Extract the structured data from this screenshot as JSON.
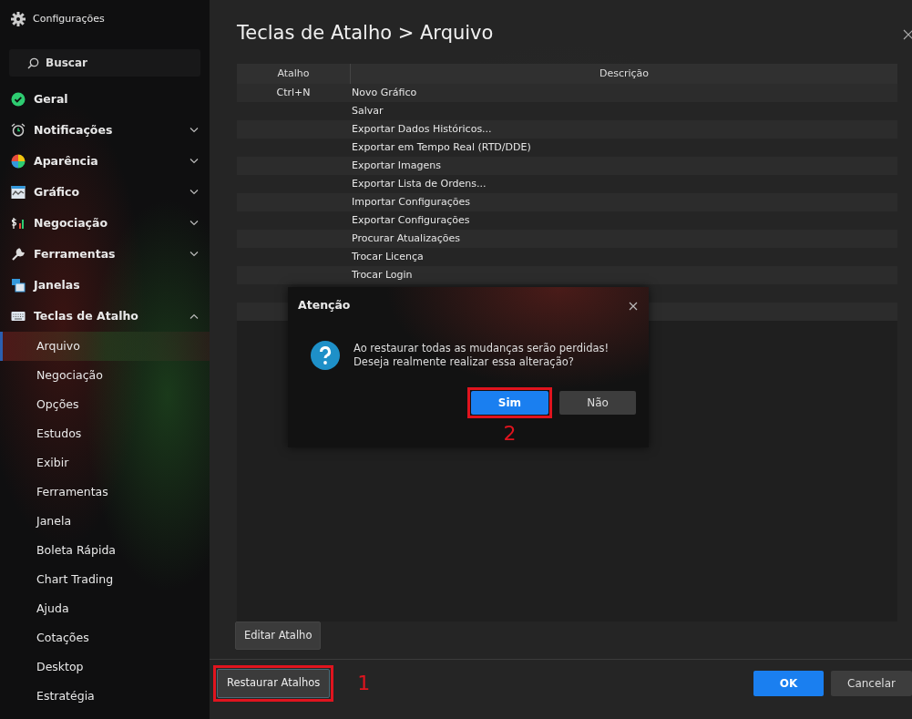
{
  "sidebar": {
    "title": "Configurações",
    "search": {
      "placeholder": "Buscar"
    },
    "items": [
      {
        "label": "Geral",
        "selected": false
      },
      {
        "label": "Notificações",
        "selected": false,
        "expanded": false
      },
      {
        "label": "Aparência",
        "selected": false,
        "expanded": false
      },
      {
        "label": "Gráfico",
        "selected": false,
        "expanded": false
      },
      {
        "label": "Negociação",
        "selected": false,
        "expanded": false
      },
      {
        "label": "Ferramentas",
        "selected": false,
        "expanded": false
      },
      {
        "label": "Janelas",
        "selected": false
      },
      {
        "label": "Teclas de Atalho",
        "selected": false,
        "expanded": true,
        "children": [
          {
            "label": "Arquivo",
            "selected": true
          },
          {
            "label": "Negociação",
            "selected": false
          },
          {
            "label": "Opções",
            "selected": false
          },
          {
            "label": "Estudos",
            "selected": false
          },
          {
            "label": "Exibir",
            "selected": false
          },
          {
            "label": "Ferramentas",
            "selected": false
          },
          {
            "label": "Janela",
            "selected": false
          },
          {
            "label": "Boleta Rápida",
            "selected": false
          },
          {
            "label": "Chart Trading",
            "selected": false
          },
          {
            "label": "Ajuda",
            "selected": false
          },
          {
            "label": "Cotações",
            "selected": false
          },
          {
            "label": "Desktop",
            "selected": false
          },
          {
            "label": "Estratégia",
            "selected": false
          }
        ]
      }
    ]
  },
  "main": {
    "title": "Teclas de Atalho > Arquivo",
    "table": {
      "columns": [
        "Atalho",
        "Descrição"
      ],
      "rows": [
        {
          "shortcut": "Ctrl+N",
          "description": "Novo Gráfico"
        },
        {
          "description": "Salvar"
        },
        {
          "description": "Exportar Dados Históricos..."
        },
        {
          "description": "Exportar em Tempo Real (RTD/DDE)"
        },
        {
          "description": "Exportar Imagens"
        },
        {
          "description": "Exportar Lista de Ordens..."
        },
        {
          "description": "Importar Configurações"
        },
        {
          "description": "Exportar Configurações"
        },
        {
          "description": "Procurar Atualizações"
        },
        {
          "description": "Trocar Licença"
        },
        {
          "description": "Trocar Login"
        },
        {
          "description": ""
        },
        {
          "description": ""
        }
      ]
    },
    "edit_button": {
      "label": "Editar Atalho"
    },
    "footer": {
      "restore_button": {
        "label": "Restaurar Atalhos",
        "highlighted": true,
        "annotation": "1"
      },
      "buttons": [
        {
          "label": "OK",
          "kind": "primary"
        },
        {
          "label": "Cancelar",
          "kind": "secondary"
        }
      ]
    }
  },
  "dialog": {
    "title": "Atenção",
    "message": [
      "Ao restaurar todas as mudanças serão perdidas!",
      "Deseja realmente realizar essa alteração?"
    ],
    "buttons": [
      {
        "label": "Sim",
        "kind": "primary",
        "highlighted": true,
        "annotation": "2"
      },
      {
        "label": "Não",
        "kind": "secondary",
        "highlighted": false
      }
    ]
  }
}
